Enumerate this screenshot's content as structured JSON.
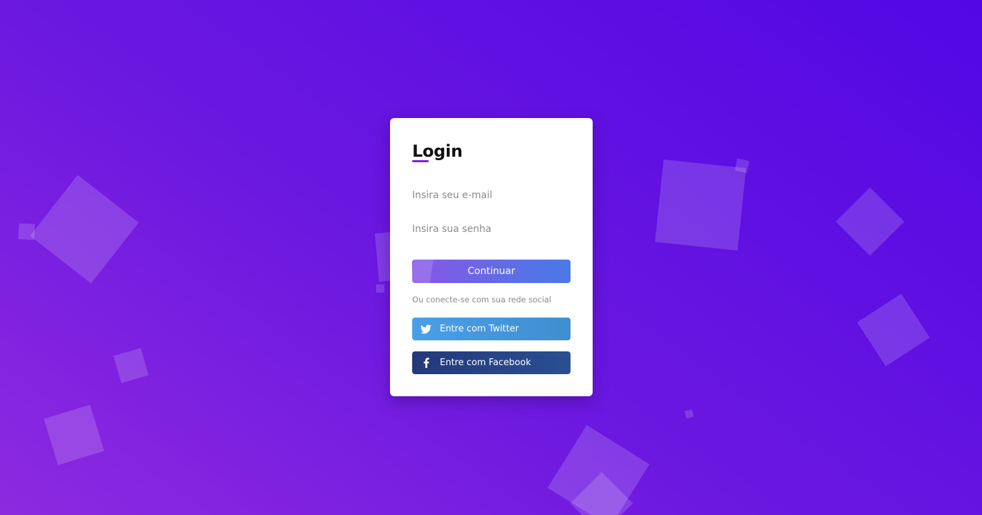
{
  "login": {
    "title": "Login",
    "email_placeholder": "Insira seu e-mail",
    "password_placeholder": "Insira sua senha",
    "continue_label": "Continuar",
    "social_text": "Ou conecte-se com sua rede social",
    "twitter_label": "Entre com Twitter",
    "facebook_label": "Entre com Facebook"
  },
  "icons": {
    "twitter": "twitter-icon",
    "facebook": "facebook-icon"
  },
  "colors": {
    "background_start": "#8d2ae0",
    "background_end": "#5207e4",
    "accent": "#7a1fe6",
    "continue_start": "#8b55e8",
    "continue_end": "#4a7ae6",
    "twitter": "#4a9fe8",
    "facebook": "#23397a"
  }
}
